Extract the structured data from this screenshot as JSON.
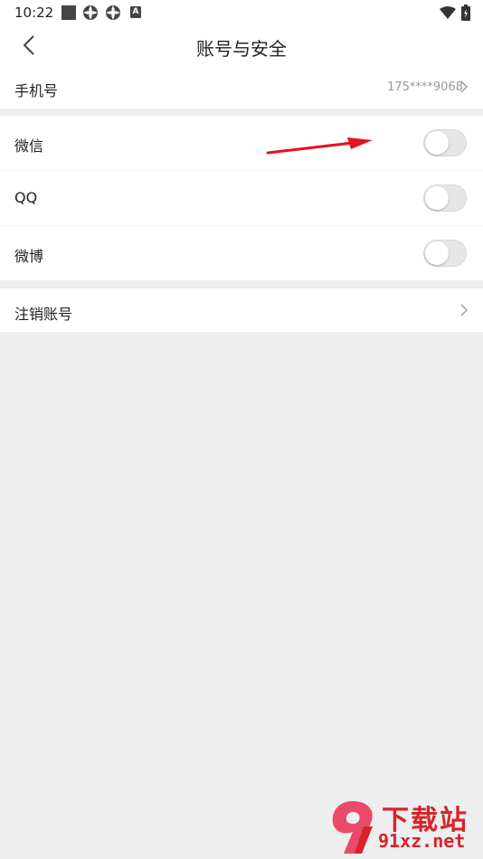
{
  "status_bar": {
    "time": "10:22",
    "icons": [
      "square-icon",
      "settings-icon",
      "settings-icon",
      "a-icon",
      "wifi-icon",
      "battery-icon"
    ],
    "a_label": "A"
  },
  "header": {
    "title": "账号与安全",
    "back_icon": "chevron-left-icon"
  },
  "phone": {
    "label": "手机号",
    "value": "175****9068"
  },
  "bindings": [
    {
      "label": "微信",
      "enabled": false
    },
    {
      "label": "QQ",
      "enabled": false
    },
    {
      "label": "微博",
      "enabled": false
    }
  ],
  "cancel_account": {
    "label": "注销账号"
  },
  "annotation": {
    "arrow_color": "#e0141e"
  },
  "watermark": {
    "title": "下载站",
    "url": "91xz.net",
    "color": "#d8232a"
  },
  "colors": {
    "background": "#eeeeee",
    "row_background": "#ffffff",
    "toggle_off": "#e6e6e6"
  }
}
